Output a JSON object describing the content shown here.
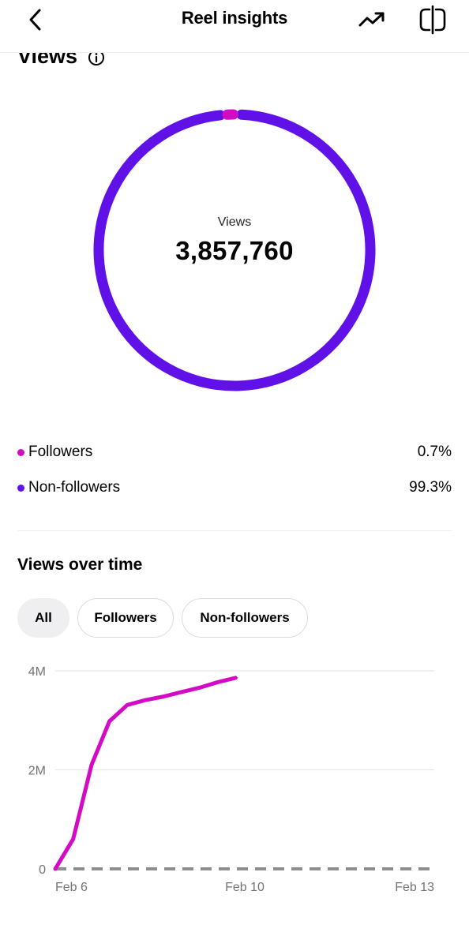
{
  "header": {
    "title": "Reel insights",
    "back_icon": "chevron-left-icon",
    "trend_icon": "trending-up-icon",
    "compare_icon": "split-view-icon"
  },
  "views": {
    "section_title": "Views",
    "info_icon": "info-icon",
    "donut_label": "Views",
    "total": "3,857,760"
  },
  "legend": [
    {
      "label": "Followers",
      "percent": "0.7%",
      "color": "#d30bc4"
    },
    {
      "label": "Non-followers",
      "percent": "99.3%",
      "color": "#5f11e8"
    }
  ],
  "views_over_time": {
    "section_title": "Views over time",
    "filters": [
      {
        "label": "All",
        "active": true
      },
      {
        "label": "Followers",
        "active": false
      },
      {
        "label": "Non-followers",
        "active": false
      }
    ]
  },
  "chart_data": {
    "type": "line",
    "x_tick_labels": [
      "Feb 6",
      "Feb 10",
      "Feb 13"
    ],
    "y_tick_labels": [
      "0",
      "2M",
      "4M"
    ],
    "ylim": [
      0,
      4000000
    ],
    "xlim": [
      0,
      7
    ],
    "series": [
      {
        "color": "#d30bc4",
        "style": "solid",
        "x": [
          0,
          0.33,
          0.67,
          1.0,
          1.33,
          1.67,
          2.0,
          2.33,
          2.67,
          3.0,
          3.33
        ],
        "values": [
          0,
          600000,
          2100000,
          2980000,
          3310000,
          3410000,
          3480000,
          3570000,
          3660000,
          3770000,
          3857760
        ]
      },
      {
        "color": "#8e8e8e",
        "style": "dashed",
        "x": [
          0,
          7
        ],
        "values": [
          0,
          0
        ]
      }
    ],
    "grid": true
  },
  "colors": {
    "followers": "#d30bc4",
    "non_followers": "#5f11e8"
  }
}
